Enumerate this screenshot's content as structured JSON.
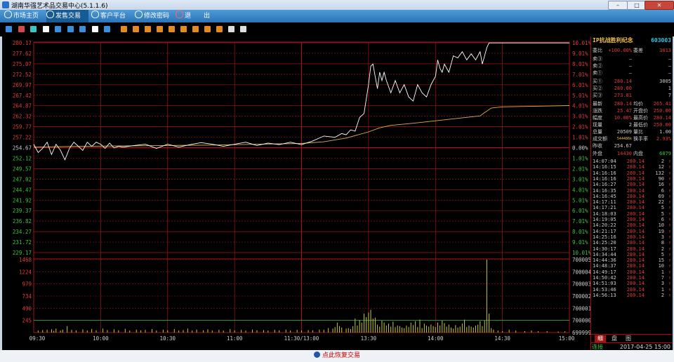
{
  "window": {
    "title": "湖南华强艺术品交易中心(5.1.1.6)",
    "min_label": "–",
    "max_label": "□",
    "close_label": "✕"
  },
  "menu": [
    {
      "label": "市场主页",
      "active": false
    },
    {
      "label": "发售交易",
      "active": true
    },
    {
      "label": "客户平台",
      "active": false
    },
    {
      "label": "修改密码",
      "active": false
    },
    {
      "label": "退",
      "active": false
    },
    {
      "label": "出",
      "active": false
    }
  ],
  "toolbar": {
    "icons": [
      "kline-icon",
      "timeline-icon",
      "depth-icon",
      "calendar-icon",
      "F3",
      "F4",
      "F5",
      "F6",
      "F7",
      "F8",
      "F9",
      "F10",
      "F11",
      "F12",
      "F13",
      "F14",
      "F15",
      "F16",
      "edit-icon",
      "gear-icon"
    ]
  },
  "colors": {
    "price_line": "#ffffff",
    "avg_line": "#e0b24a",
    "grid": "#a01515",
    "up": "#e03a3a",
    "down": "#3ac43a",
    "volume_bar": "#c9c930"
  },
  "chart_data": {
    "type": "line",
    "title": "",
    "x_ticks": [
      "09:30",
      "10:00",
      "10:30",
      "11:00",
      "11:30/13:00",
      "13:30",
      "14:00",
      "14:30",
      "15:00"
    ],
    "price_ticks_left": [
      "280.17",
      "277.62",
      "275.07",
      "272.52",
      "269.97",
      "267.42",
      "264.87",
      "262.32",
      "259.77",
      "257.22",
      "254.67",
      "252.12",
      "249.57",
      "247.02",
      "244.47",
      "241.92",
      "239.37",
      "236.82",
      "234.27",
      "231.72",
      "229.17"
    ],
    "price_ticks_right": [
      "10.01%",
      "9.01%",
      "8.01%",
      "7.01%",
      "6.01%",
      "5.01%",
      "4.01%",
      "3.01%",
      "2.01%",
      "1.01%",
      "0.00%",
      "1.01%",
      "2.01%",
      "3.01%",
      "4.01%",
      "5.01%",
      "6.01%",
      "7.01%",
      "8.01%",
      "9.01%",
      "10.01%"
    ],
    "ylim": [
      229.17,
      280.17
    ],
    "prev_close": 254.67,
    "series": [
      {
        "name": "",
        "points": [
          [
            0,
            255.5
          ],
          [
            2,
            253.5
          ],
          [
            4,
            254.5
          ],
          [
            6,
            256
          ],
          [
            8,
            253
          ],
          [
            10,
            255.5
          ],
          [
            12,
            254
          ],
          [
            14,
            251.7
          ],
          [
            16,
            254.5
          ],
          [
            18,
            256
          ],
          [
            20,
            255
          ],
          [
            22,
            254
          ],
          [
            24,
            256
          ],
          [
            26,
            255
          ],
          [
            28,
            256
          ],
          [
            30,
            255.5
          ],
          [
            32,
            254.5
          ],
          [
            34,
            255.8
          ],
          [
            36,
            254.6
          ],
          [
            38,
            255
          ],
          [
            40,
            254.8
          ],
          [
            45,
            255.2
          ],
          [
            50,
            255.5
          ],
          [
            55,
            254.5
          ],
          [
            60,
            255.5
          ],
          [
            65,
            254.8
          ],
          [
            70,
            255.4
          ],
          [
            75,
            255.9
          ],
          [
            80,
            255.5
          ],
          [
            85,
            255
          ],
          [
            90,
            255.5
          ],
          [
            95,
            256
          ],
          [
            100,
            255.2
          ],
          [
            105,
            255.8
          ],
          [
            110,
            255.4
          ],
          [
            115,
            256
          ],
          [
            120,
            255.4
          ],
          [
            125,
            256.3
          ],
          [
            130,
            257.5
          ],
          [
            135,
            257.2
          ],
          [
            138,
            258.1
          ],
          [
            140,
            257.8
          ],
          [
            142,
            259
          ],
          [
            144,
            258.7
          ],
          [
            146,
            262
          ],
          [
            148,
            263
          ],
          [
            150,
            270
          ],
          [
            151,
            274.5
          ],
          [
            152,
            275
          ],
          [
            153,
            272
          ],
          [
            154,
            269
          ],
          [
            155,
            273
          ],
          [
            156,
            271
          ],
          [
            157,
            273
          ],
          [
            158,
            271
          ],
          [
            160,
            268
          ],
          [
            162,
            271
          ],
          [
            164,
            268
          ],
          [
            166,
            270
          ],
          [
            168,
            267
          ],
          [
            170,
            266
          ],
          [
            172,
            270
          ],
          [
            174,
            268
          ],
          [
            176,
            267
          ],
          [
            178,
            270
          ],
          [
            180,
            272
          ],
          [
            181,
            276
          ],
          [
            182,
            274
          ],
          [
            183,
            273
          ],
          [
            184,
            275
          ],
          [
            186,
            273
          ],
          [
            188,
            277
          ],
          [
            190,
            276.5
          ],
          [
            192,
            278
          ],
          [
            194,
            276
          ],
          [
            196,
            277.5
          ],
          [
            198,
            276
          ],
          [
            200,
            278
          ],
          [
            201,
            275
          ],
          [
            203,
            279
          ],
          [
            204,
            280.14
          ],
          [
            240,
            280.14
          ]
        ]
      },
      {
        "name": "",
        "points": [
          [
            0,
            254.8
          ],
          [
            20,
            255
          ],
          [
            40,
            255.1
          ],
          [
            60,
            255.2
          ],
          [
            80,
            255.3
          ],
          [
            100,
            255.5
          ],
          [
            120,
            255.7
          ],
          [
            130,
            256.1
          ],
          [
            140,
            257
          ],
          [
            150,
            258.5
          ],
          [
            155,
            259.5
          ],
          [
            160,
            260.1
          ],
          [
            170,
            260.6
          ],
          [
            180,
            261.2
          ],
          [
            190,
            261.8
          ],
          [
            200,
            262.4
          ],
          [
            202,
            263.2
          ],
          [
            205,
            264.3
          ],
          [
            210,
            264.6
          ],
          [
            220,
            264.7
          ],
          [
            240,
            264.9
          ]
        ]
      }
    ],
    "volume_ticks_left": [
      "1468",
      "1224",
      "979",
      "734",
      "490",
      "245"
    ],
    "volume_ticks_right": [
      "700005",
      "700004",
      "700003",
      "700002",
      "700001",
      "700000",
      "699999"
    ],
    "volume_max": 1468,
    "volume": [
      [
        2,
        40
      ],
      [
        4,
        50
      ],
      [
        6,
        55
      ],
      [
        8,
        65
      ],
      [
        9,
        35
      ],
      [
        10,
        80
      ],
      [
        12,
        40
      ],
      [
        13,
        60
      ],
      [
        15,
        130
      ],
      [
        17,
        55
      ],
      [
        19,
        45
      ],
      [
        22,
        65
      ],
      [
        24,
        40
      ],
      [
        26,
        75
      ],
      [
        28,
        45
      ],
      [
        31,
        80
      ],
      [
        33,
        50
      ],
      [
        36,
        65
      ],
      [
        38,
        45
      ],
      [
        41,
        75
      ],
      [
        43,
        40
      ],
      [
        46,
        60
      ],
      [
        48,
        45
      ],
      [
        50,
        55
      ],
      [
        53,
        70
      ],
      [
        55,
        40
      ],
      [
        58,
        60
      ],
      [
        60,
        45
      ],
      [
        63,
        70
      ],
      [
        65,
        40
      ],
      [
        67,
        50
      ],
      [
        69,
        80
      ],
      [
        71,
        40
      ],
      [
        73,
        60
      ],
      [
        76,
        45
      ],
      [
        78,
        65
      ],
      [
        80,
        40
      ],
      [
        83,
        55
      ],
      [
        85,
        40
      ],
      [
        88,
        70
      ],
      [
        90,
        45
      ],
      [
        93,
        55
      ],
      [
        95,
        40
      ],
      [
        98,
        60
      ],
      [
        100,
        45
      ],
      [
        103,
        50
      ],
      [
        105,
        40
      ],
      [
        108,
        55
      ],
      [
        110,
        45
      ],
      [
        113,
        60
      ],
      [
        115,
        40
      ],
      [
        118,
        55
      ],
      [
        120,
        40
      ],
      [
        123,
        50
      ],
      [
        125,
        45
      ],
      [
        128,
        60
      ],
      [
        130,
        55
      ],
      [
        132,
        90
      ],
      [
        134,
        80
      ],
      [
        135,
        110
      ],
      [
        136,
        200
      ],
      [
        137,
        130
      ],
      [
        138,
        100
      ],
      [
        140,
        80
      ],
      [
        141,
        90
      ],
      [
        142,
        70
      ],
      [
        143,
        130
      ],
      [
        144,
        280
      ],
      [
        145,
        140
      ],
      [
        146,
        250
      ],
      [
        147,
        200
      ],
      [
        148,
        380
      ],
      [
        149,
        310
      ],
      [
        150,
        400
      ],
      [
        151,
        460
      ],
      [
        152,
        280
      ],
      [
        153,
        300
      ],
      [
        154,
        160
      ],
      [
        155,
        120
      ],
      [
        156,
        240
      ],
      [
        157,
        200
      ],
      [
        158,
        140
      ],
      [
        159,
        180
      ],
      [
        160,
        120
      ],
      [
        161,
        220
      ],
      [
        162,
        110
      ],
      [
        163,
        140
      ],
      [
        164,
        130
      ],
      [
        165,
        100
      ],
      [
        166,
        90
      ],
      [
        167,
        140
      ],
      [
        168,
        110
      ],
      [
        169,
        200
      ],
      [
        170,
        150
      ],
      [
        171,
        230
      ],
      [
        172,
        110
      ],
      [
        173,
        260
      ],
      [
        174,
        90
      ],
      [
        175,
        180
      ],
      [
        176,
        140
      ],
      [
        177,
        120
      ],
      [
        178,
        160
      ],
      [
        179,
        130
      ],
      [
        180,
        110
      ],
      [
        181,
        200
      ],
      [
        182,
        140
      ],
      [
        183,
        240
      ],
      [
        184,
        190
      ],
      [
        185,
        120
      ],
      [
        186,
        160
      ],
      [
        187,
        100
      ],
      [
        188,
        80
      ],
      [
        189,
        150
      ],
      [
        190,
        100
      ],
      [
        191,
        120
      ],
      [
        192,
        180
      ],
      [
        193,
        260
      ],
      [
        194,
        110
      ],
      [
        195,
        140
      ],
      [
        196,
        120
      ],
      [
        197,
        100
      ],
      [
        198,
        140
      ],
      [
        199,
        160
      ],
      [
        200,
        230
      ],
      [
        201,
        130
      ],
      [
        202,
        240
      ],
      [
        203,
        1468
      ],
      [
        204,
        380
      ],
      [
        205,
        90
      ],
      [
        206,
        60
      ],
      [
        208,
        40
      ],
      [
        210,
        30
      ],
      [
        213,
        60
      ],
      [
        216,
        40
      ],
      [
        220,
        30
      ],
      [
        223,
        40
      ],
      [
        226,
        25
      ],
      [
        230,
        30
      ],
      [
        235,
        20
      ],
      [
        238,
        25
      ]
    ],
    "volume_baseline": 245
  },
  "panel": {
    "stock_name": "IP抗战胜利纪念",
    "stock_code": "603003",
    "weibi_label": "委比",
    "weibi_value": "+100.00%",
    "weicha_label": "委差",
    "weicha_value": "3013",
    "sells": [
      {
        "label": "卖③",
        "price": "—",
        "vol": "—"
      },
      {
        "label": "卖②",
        "price": "—",
        "vol": "—"
      },
      {
        "label": "卖①",
        "price": "—",
        "vol": "—"
      }
    ],
    "buys": [
      {
        "label": "买①",
        "price": "280.14",
        "vol": "3005"
      },
      {
        "label": "买②",
        "price": "280.00",
        "vol": "1"
      },
      {
        "label": "买③",
        "price": "273.81",
        "vol": "7"
      }
    ],
    "stats": [
      {
        "l1": "最新",
        "v1": "280.14",
        "l2": "均价",
        "v2": "265.41"
      },
      {
        "l1": "涨跌",
        "v1": "25.47",
        "l2": "开盘价",
        "v2": "250.00"
      },
      {
        "l1": "幅度",
        "v1": "10.00%",
        "l2": "最高价",
        "v2": "280.14"
      },
      {
        "l1": "现量",
        "v1": "2",
        "l2": "最低价",
        "v2": "250.00"
      },
      {
        "l1": "总量",
        "v1": "20509",
        "l2": "量比",
        "v2": "1.00"
      },
      {
        "l1": "成交额",
        "v1": "544486k",
        "l2": "换手率",
        "v2": "2.93%"
      },
      {
        "l1": "昨收",
        "v1": "254.67",
        "l2": "",
        "v2": ""
      }
    ],
    "outer_label": "外盘",
    "outer_value": "14430",
    "inner_label": "内盘",
    "inner_value": "6079",
    "ticks": [
      {
        "time": "14:07:04",
        "price": "280.14",
        "vol": "2",
        "arrow": "↑"
      },
      {
        "time": "14:16:15",
        "price": "280.14",
        "vol": "12",
        "arrow": "↑"
      },
      {
        "time": "14:16:16",
        "price": "280.14",
        "vol": "132",
        "arrow": "↑"
      },
      {
        "time": "14:16:16",
        "price": "280.14",
        "vol": "90",
        "arrow": "↑"
      },
      {
        "time": "14:16:27",
        "price": "280.14",
        "vol": "16",
        "arrow": "↑"
      },
      {
        "time": "14:16:35",
        "price": "280.14",
        "vol": "6",
        "arrow": "↑"
      },
      {
        "time": "14:16:45",
        "price": "280.14",
        "vol": "69",
        "arrow": "↑"
      },
      {
        "time": "14:17:11",
        "price": "280.14",
        "vol": "22",
        "arrow": "↑"
      },
      {
        "time": "14:17:21",
        "price": "280.14",
        "vol": "5",
        "arrow": "↑"
      },
      {
        "time": "14:18:03",
        "price": "280.14",
        "vol": "5",
        "arrow": "↑"
      },
      {
        "time": "14:19:05",
        "price": "280.14",
        "vol": "6",
        "arrow": "↑"
      },
      {
        "time": "14:20:22",
        "price": "280.14",
        "vol": "10",
        "arrow": "↑"
      },
      {
        "time": "14:21:17",
        "price": "280.14",
        "vol": "19",
        "arrow": "↑"
      },
      {
        "time": "14:25:16",
        "price": "280.14",
        "vol": "3",
        "arrow": "↑"
      },
      {
        "time": "14:25:20",
        "price": "280.14",
        "vol": "8",
        "arrow": "↑"
      },
      {
        "time": "14:30:17",
        "price": "280.14",
        "vol": "2",
        "arrow": "↑"
      },
      {
        "time": "14:34:44",
        "price": "280.14",
        "vol": "5",
        "arrow": "↑"
      },
      {
        "time": "14:44:36",
        "price": "280.14",
        "vol": "15",
        "arrow": "↑"
      },
      {
        "time": "14:48:37",
        "price": "280.14",
        "vol": "10",
        "arrow": "↑"
      },
      {
        "time": "14:49:17",
        "price": "280.14",
        "vol": "1",
        "arrow": "↑"
      },
      {
        "time": "14:50:42",
        "price": "280.14",
        "vol": "7",
        "arrow": "↑"
      },
      {
        "time": "14:51:03",
        "price": "280.14",
        "vol": "3",
        "arrow": "↑"
      },
      {
        "time": "14:53:46",
        "price": "280.14",
        "vol": "1",
        "arrow": "↑"
      },
      {
        "time": "14:56:13",
        "price": "280.14",
        "vol": "2",
        "arrow": "↑"
      }
    ],
    "bottom_tabs": [
      "细",
      "盘",
      "图"
    ],
    "status_label": "连接",
    "status_datetime": "2017-04-25 15:00"
  },
  "footer": {
    "label": "点此恢复交易"
  }
}
